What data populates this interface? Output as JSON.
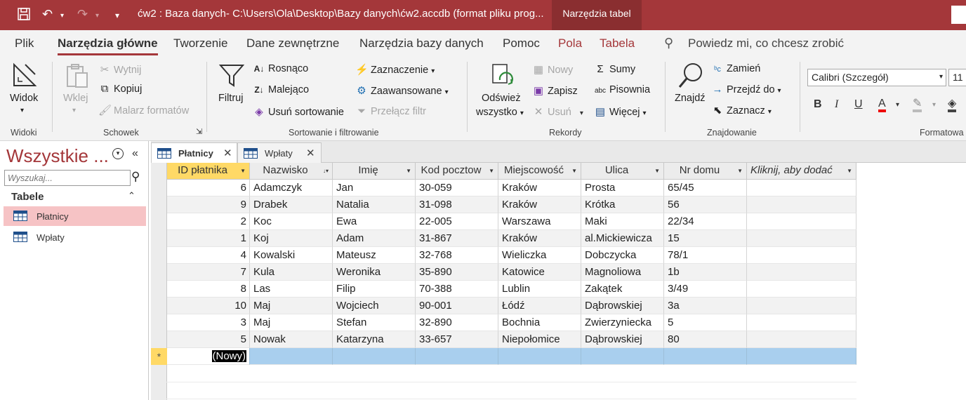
{
  "titlebar": {
    "title": "ćw2 : Baza danych- C:\\Users\\Ola\\Desktop\\Bazy danych\\ćw2.accdb (format pliku prog...",
    "context_tab": "Narzędzia tabel"
  },
  "menu": {
    "items": [
      "Plik",
      "Narzędzia główne",
      "Tworzenie",
      "Dane zewnętrzne",
      "Narzędzia bazy danych",
      "Pomoc",
      "Pola",
      "Tabela"
    ],
    "active": "Narzędzia główne",
    "tell_me": "Powiedz mi, co chcesz zrobić"
  },
  "ribbon": {
    "widoki": {
      "label": "Widoki",
      "widok": "Widok"
    },
    "schowek": {
      "label": "Schowek",
      "wklej": "Wklej",
      "wytnij": "Wytnij",
      "kopiuj": "Kopiuj",
      "malarz": "Malarz formatów"
    },
    "sortowanie": {
      "label": "Sortowanie i filtrowanie",
      "filtruj": "Filtruj",
      "rosnaco": "Rosnąco",
      "malejaco": "Malejąco",
      "usun_sort": "Usuń sortowanie",
      "zaznaczenie": "Zaznaczenie",
      "zaawansowane": "Zaawansowane",
      "przelacz": "Przełącz filtr"
    },
    "rekordy": {
      "label": "Rekordy",
      "odswiez_1": "Odśwież",
      "odswiez_2": "wszystko",
      "nowy": "Nowy",
      "zapisz": "Zapisz",
      "usun": "Usuń",
      "sumy": "Sumy",
      "pisownia": "Pisownia",
      "wiecej": "Więcej"
    },
    "znajdowanie": {
      "label": "Znajdowanie",
      "znajdz": "Znajdź",
      "zamien": "Zamień",
      "przejdz": "Przejdź do",
      "zaznacz": "Zaznacz"
    },
    "formatowanie": {
      "label": "Formatowa",
      "font": "Calibri (Szczegół)",
      "size": "11",
      "bold": "B",
      "italic": "I",
      "underline": "U"
    }
  },
  "nav": {
    "title": "Wszystkie ...",
    "search_placeholder": "Wyszukaj...",
    "group": "Tabele",
    "items": [
      "Płatnicy",
      "Wpłaty"
    ]
  },
  "tabs": [
    "Płatnicy",
    "Wpłaty"
  ],
  "table": {
    "columns": [
      "ID płatnika",
      "Nazwisko",
      "Imię",
      "Kod pocztow",
      "Miejscowość",
      "Ulica",
      "Nr domu",
      "Kliknij, aby dodać"
    ],
    "rows": [
      [
        "6",
        "Adamczyk",
        "Jan",
        "30-059",
        "Kraków",
        "Prosta",
        "65/45"
      ],
      [
        "9",
        "Drabek",
        "Natalia",
        "31-098",
        "Kraków",
        "Krótka",
        "56"
      ],
      [
        "2",
        "Koc",
        "Ewa",
        "22-005",
        "Warszawa",
        "Maki",
        "22/34"
      ],
      [
        "1",
        "Koj",
        "Adam",
        "31-867",
        "Kraków",
        "al.Mickiewicza",
        "15"
      ],
      [
        "4",
        "Kowalski",
        "Mateusz",
        "32-768",
        "Wieliczka",
        "Dobczycka",
        "78/1"
      ],
      [
        "7",
        "Kula",
        "Weronika",
        "35-890",
        "Katowice",
        "Magnoliowa",
        "1b"
      ],
      [
        "8",
        "Las",
        "Filip",
        "70-388",
        "Lublin",
        "Zakątek",
        "3/49"
      ],
      [
        "10",
        "Maj",
        "Wojciech",
        "90-001",
        "Łódź",
        "Dąbrowskiej",
        "3a"
      ],
      [
        "3",
        "Maj",
        "Stefan",
        "32-890",
        "Bochnia",
        "Zwierzyniecka",
        "5"
      ],
      [
        "5",
        "Nowak",
        "Katarzyna",
        "33-657",
        "Niepołomice",
        "Dąbrowskiej",
        "80"
      ]
    ],
    "new_row_value": "(Nowy)",
    "new_row_marker": "*"
  }
}
